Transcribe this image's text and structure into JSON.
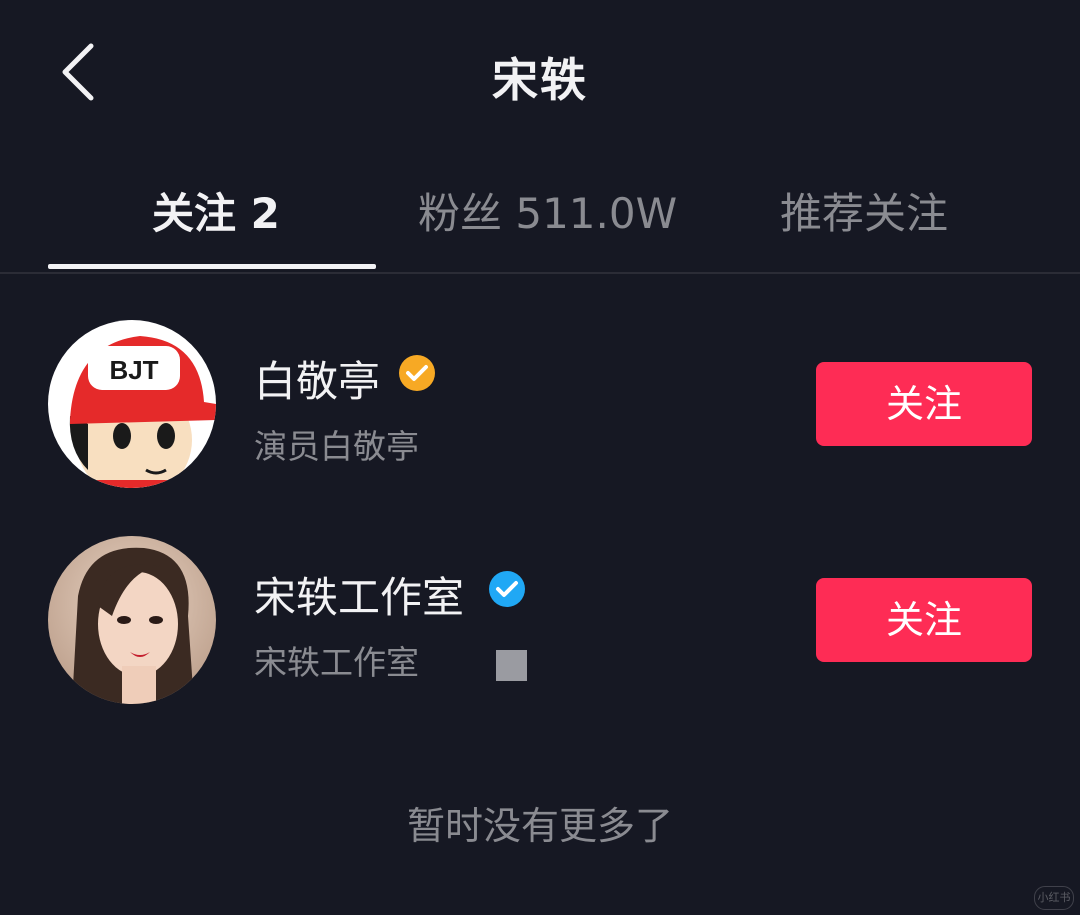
{
  "header": {
    "title": "宋轶"
  },
  "tabs": [
    {
      "label": "关注 2",
      "active": true
    },
    {
      "label": "粉丝 511.0W",
      "active": false
    },
    {
      "label": "推荐关注",
      "active": false
    }
  ],
  "users": [
    {
      "name": "白敬亭",
      "description": "演员白敬亭",
      "badge": "verified-gold-icon",
      "badge_color": "#f7a924",
      "follow_label": "关注",
      "avatar_text": "BJT"
    },
    {
      "name": "宋轶工作室",
      "description": "宋轶工作室",
      "badge": "verified-blue-icon",
      "badge_color": "#20a8f5",
      "follow_label": "关注"
    }
  ],
  "footer": {
    "no_more": "暂时没有更多了"
  },
  "watermark": "小红书",
  "colors": {
    "background": "#161823",
    "accent": "#fe2c55",
    "text_primary": "#f2f2f4",
    "text_secondary": "#8a8b91"
  }
}
